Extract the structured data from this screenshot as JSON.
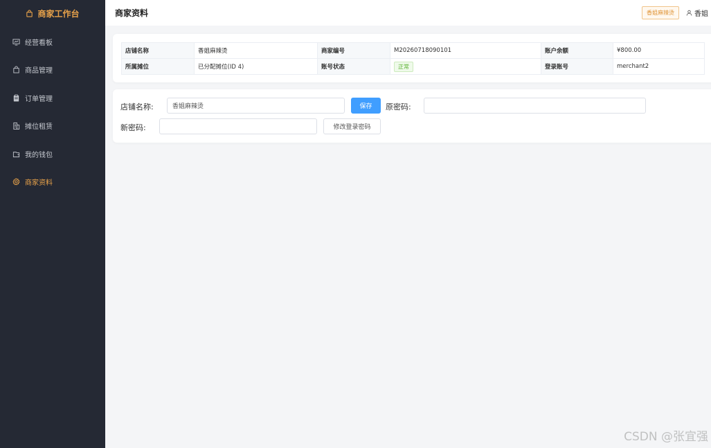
{
  "sidebar": {
    "brand": "商家工作台",
    "items": [
      {
        "label": "经营看板",
        "icon": "monitor-chart-icon"
      },
      {
        "label": "商品管理",
        "icon": "shopping-bag-icon"
      },
      {
        "label": "订单管理",
        "icon": "clipboard-icon"
      },
      {
        "label": "摊位租赁",
        "icon": "building-icon"
      },
      {
        "label": "我的钱包",
        "icon": "wallet-icon"
      },
      {
        "label": "商家资料",
        "icon": "gear-icon",
        "active": true
      }
    ]
  },
  "header": {
    "title": "商家资料",
    "shop_tag": "香姐麻辣烫",
    "user_name": "香姐"
  },
  "info": {
    "shop_name_label": "店铺名称",
    "shop_name_value": "香姐麻辣烫",
    "merchant_no_label": "商家编号",
    "merchant_no_value": "M20260718090101",
    "balance_label": "账户余额",
    "balance_value": "¥800.00",
    "stall_label": "所属摊位",
    "stall_value": "已分配摊位(ID 4)",
    "status_label": "账号状态",
    "status_value": "正常",
    "login_label": "登录账号",
    "login_value": "merchant2"
  },
  "form": {
    "shop_name_label": "店铺名称:",
    "shop_name_value": "香姐麻辣烫",
    "save_label": "保存",
    "old_password_label": "原密码:",
    "old_password_value": "",
    "new_password_label": "新密码:",
    "new_password_value": "",
    "change_password_label": "修改登录密码"
  },
  "watermark": "CSDN @张宜强",
  "colors": {
    "accent": "#e8a24a",
    "primary_button": "#409eff",
    "sidebar_bg": "#252934",
    "status_green": "#5bb232"
  }
}
